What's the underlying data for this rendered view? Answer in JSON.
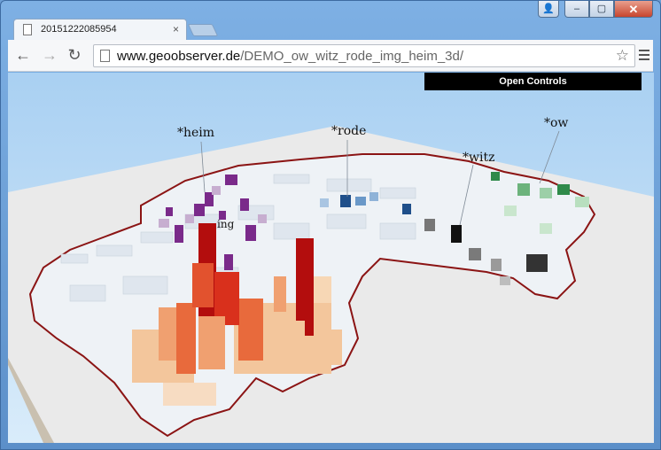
{
  "window": {
    "tab_title": "20151222085954",
    "controls": {
      "user": "👤",
      "minimize": "–",
      "maximize": "▢",
      "close": "✕"
    }
  },
  "toolbar": {
    "back": "←",
    "forward": "→",
    "reload": "↻",
    "url_host": "www.geoobserver.de",
    "url_path": "/DEMO_ow_witz_rode_img_heim_3d/",
    "bookmark": "☆"
  },
  "page": {
    "open_controls_label": "Open Controls",
    "labels": {
      "heim": "*heim",
      "rode": "*rode",
      "witz": "*witz",
      "ow": "*ow",
      "ing": "ing"
    },
    "colors": {
      "sky_top": "#a9d0f2",
      "sky_bottom": "#d9ecfa",
      "plane": "#eaeaea",
      "border": "#8b1414",
      "heim": "#7a2a8a",
      "rode": "#1f4f8a",
      "witz": "#333333",
      "ow": "#2f8a4a",
      "ing": "#d9301c"
    }
  }
}
